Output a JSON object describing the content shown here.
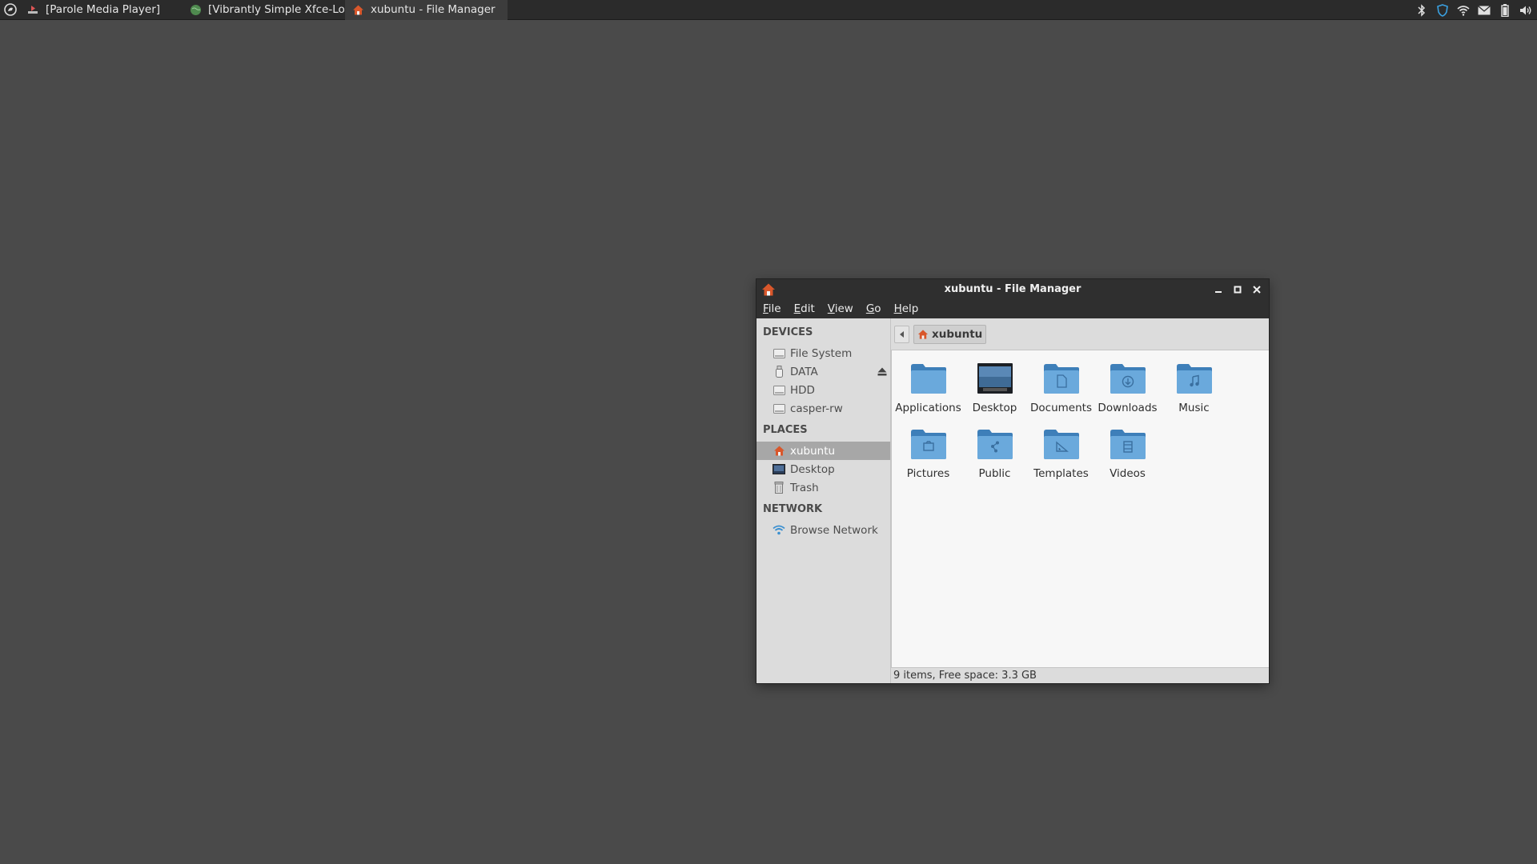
{
  "panel": {
    "tasks": [
      {
        "label": "[Parole Media Player]",
        "icon": "media-player-icon",
        "active": false
      },
      {
        "label": "[Vibrantly Simple Xfce-Loo...",
        "icon": "browser-globe-icon",
        "active": false
      },
      {
        "label": "xubuntu - File Manager",
        "icon": "home-folder-icon",
        "active": true
      }
    ],
    "tray": [
      "bluetooth-icon",
      "update-shield-icon",
      "wifi-icon",
      "mail-icon",
      "battery-icon",
      "volume-icon"
    ]
  },
  "window": {
    "title": "xubuntu - File Manager",
    "menu": [
      {
        "mnemonic": "F",
        "rest": "ile"
      },
      {
        "mnemonic": "E",
        "rest": "dit"
      },
      {
        "mnemonic": "V",
        "rest": "iew"
      },
      {
        "mnemonic": "G",
        "rest": "o"
      },
      {
        "mnemonic": "H",
        "rest": "elp"
      }
    ],
    "sidebar": {
      "devices_header": "DEVICES",
      "devices": [
        "File System",
        "DATA",
        "HDD",
        "casper-rw"
      ],
      "places_header": "PLACES",
      "places": [
        "xubuntu",
        "Desktop",
        "Trash"
      ],
      "network_header": "NETWORK",
      "network": [
        "Browse Network"
      ]
    },
    "path": {
      "current": "xubuntu"
    },
    "items": [
      "Applications",
      "Desktop",
      "Documents",
      "Downloads",
      "Music",
      "Pictures",
      "Public",
      "Templates",
      "Videos"
    ],
    "status": "9 items, Free space: 3.3 GB"
  },
  "colors": {
    "desktop": "#4a4a4a",
    "panel": "#2b2b2b",
    "folder_blue": "#5c9fd6",
    "home_orange": "#d9572b",
    "selected": "#a7a7a7"
  }
}
